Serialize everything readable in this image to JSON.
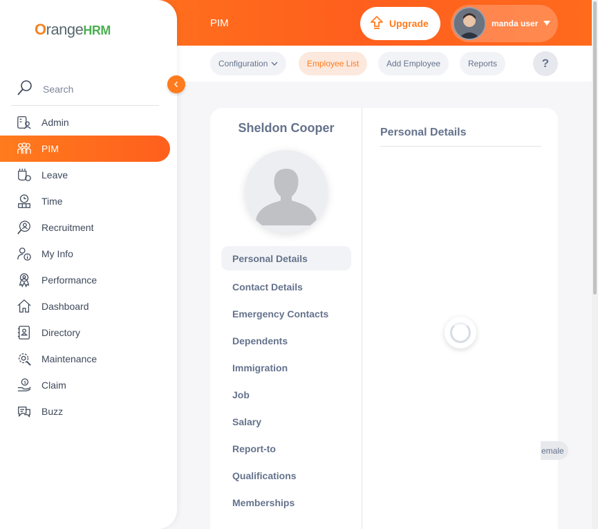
{
  "brand": {
    "logo_o": "O",
    "logo_text": "range",
    "logo_hrm": "HRM"
  },
  "header": {
    "module_title": "PIM",
    "upgrade_label": "Upgrade",
    "user_name": "manda user"
  },
  "subnav": {
    "items": [
      {
        "label": "Configuration"
      },
      {
        "label": "Employee List"
      },
      {
        "label": "Add Employee"
      },
      {
        "label": "Reports"
      }
    ],
    "help_label": "?"
  },
  "sidebar": {
    "search_label": "Search",
    "items": [
      {
        "label": "Admin",
        "icon": "admin-icon"
      },
      {
        "label": "PIM",
        "icon": "pim-icon"
      },
      {
        "label": "Leave",
        "icon": "leave-icon"
      },
      {
        "label": "Time",
        "icon": "time-icon"
      },
      {
        "label": "Recruitment",
        "icon": "recruitment-icon"
      },
      {
        "label": "My Info",
        "icon": "my-info-icon"
      },
      {
        "label": "Performance",
        "icon": "performance-icon"
      },
      {
        "label": "Dashboard",
        "icon": "dashboard-icon"
      },
      {
        "label": "Directory",
        "icon": "directory-icon"
      },
      {
        "label": "Maintenance",
        "icon": "maintenance-icon"
      },
      {
        "label": "Claim",
        "icon": "claim-icon"
      },
      {
        "label": "Buzz",
        "icon": "buzz-icon"
      }
    ]
  },
  "employee": {
    "name": "Sheldon Cooper",
    "tabs": [
      {
        "label": "Personal Details"
      },
      {
        "label": "Contact Details"
      },
      {
        "label": "Emergency Contacts"
      },
      {
        "label": "Dependents"
      },
      {
        "label": "Immigration"
      },
      {
        "label": "Job"
      },
      {
        "label": "Salary"
      },
      {
        "label": "Report-to"
      },
      {
        "label": "Qualifications"
      },
      {
        "label": "Memberships"
      }
    ]
  },
  "section": {
    "title": "Personal Details",
    "peek_text": "emale"
  },
  "colors": {
    "accent": "#ff7b1d",
    "text": "#64728c"
  }
}
